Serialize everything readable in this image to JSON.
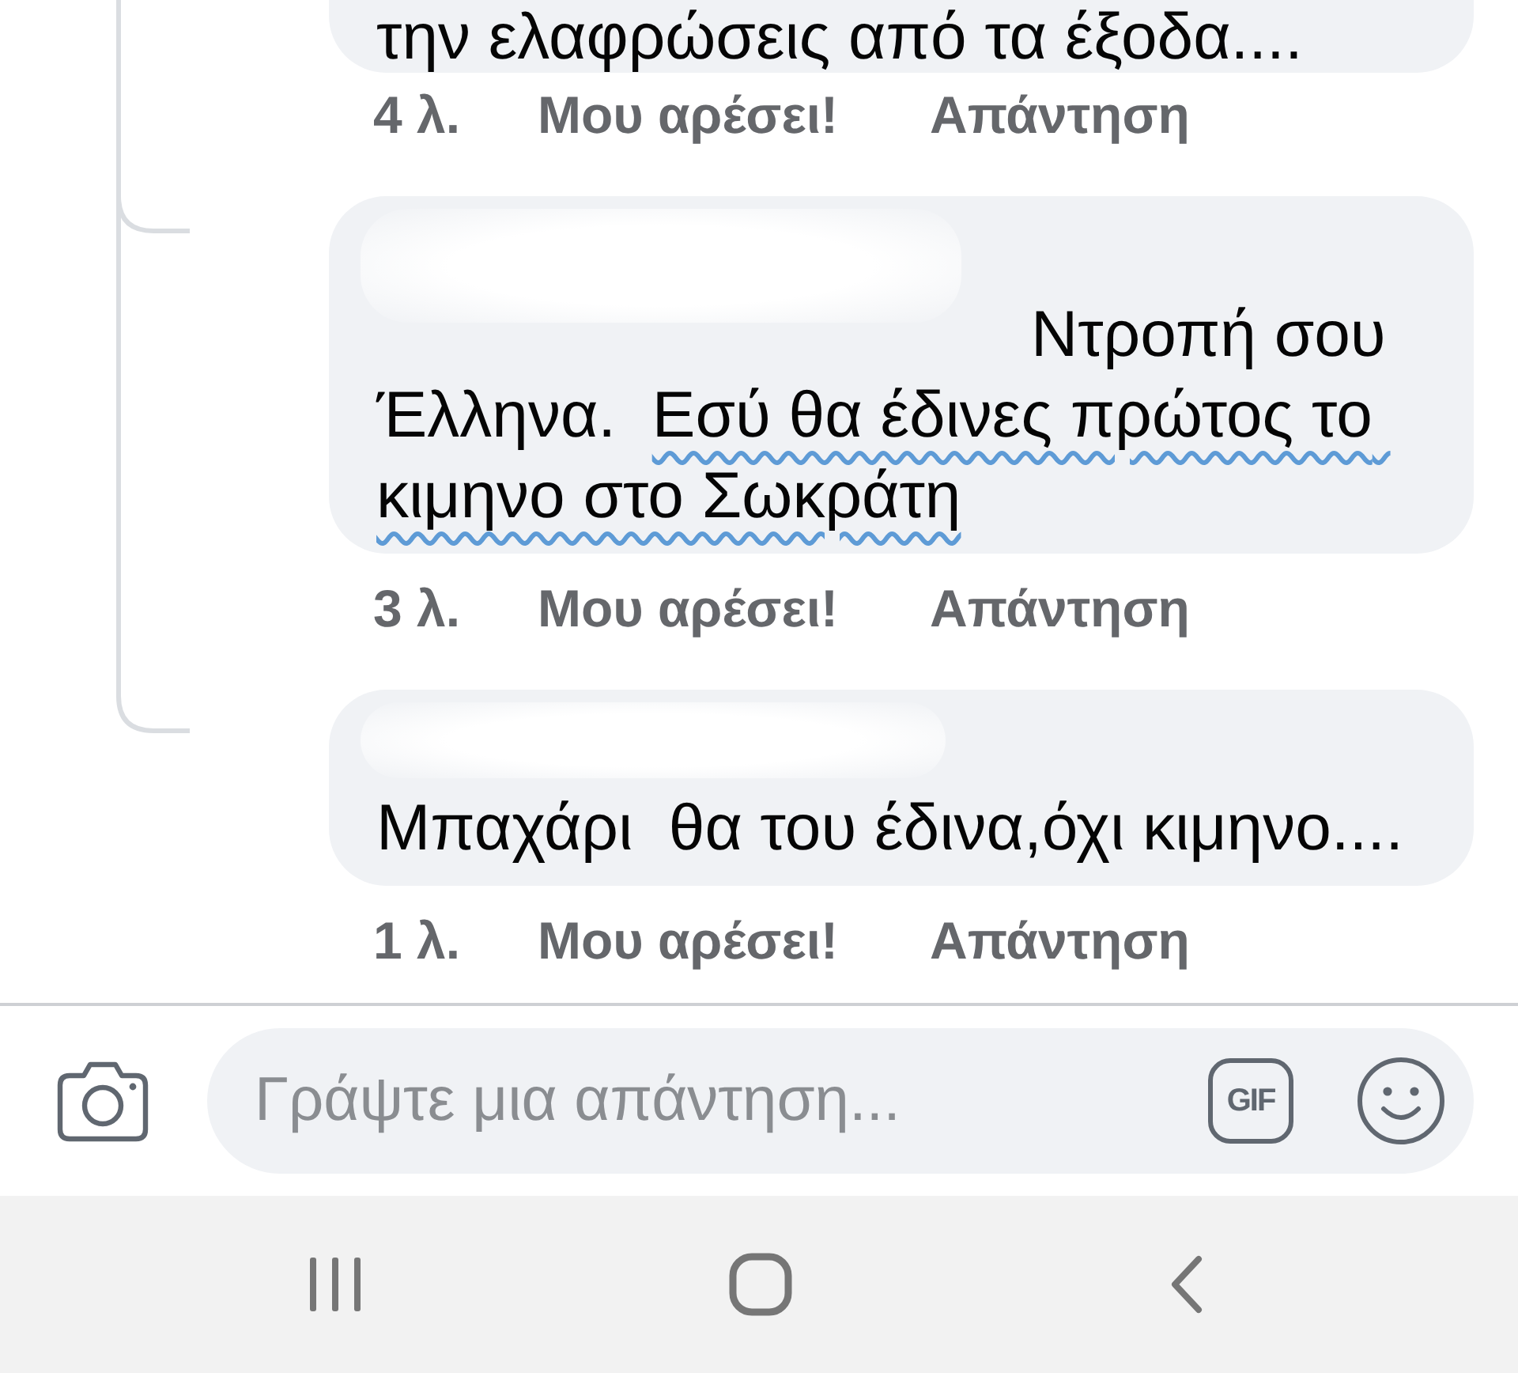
{
  "comments": [
    {
      "author_redacted": false,
      "mention_redacted": false,
      "segments": [
        {
          "kind": "plain",
          "text": "την ελαφρώσεις από τα έξοδα...."
        }
      ],
      "time": "4 λ.",
      "like": "Μου αρέσει!",
      "reply": "Απάντηση"
    },
    {
      "author_redacted": true,
      "mention_redacted": true,
      "segments": [
        {
          "kind": "plain",
          "text": "Ντροπή σου Έλληνα.  "
        },
        {
          "kind": "underlined",
          "text": "Εσύ θα έδινες πρώτος το κιμηνο στο Σωκράτη"
        }
      ],
      "time": "3 λ.",
      "like": "Μου αρέσει!",
      "reply": "Απάντηση"
    },
    {
      "author_redacted": true,
      "mention_redacted": false,
      "segments": [
        {
          "kind": "plain",
          "text": "Μπαχάρι  θα του έδινα,όχι κιμηνο...."
        }
      ],
      "time": "1 λ.",
      "like": "Μου αρέσει!",
      "reply": "Απάντηση"
    }
  ],
  "reply_bar": {
    "placeholder": "Γράψτε μια απάντηση...",
    "gif_label": "GIF"
  }
}
